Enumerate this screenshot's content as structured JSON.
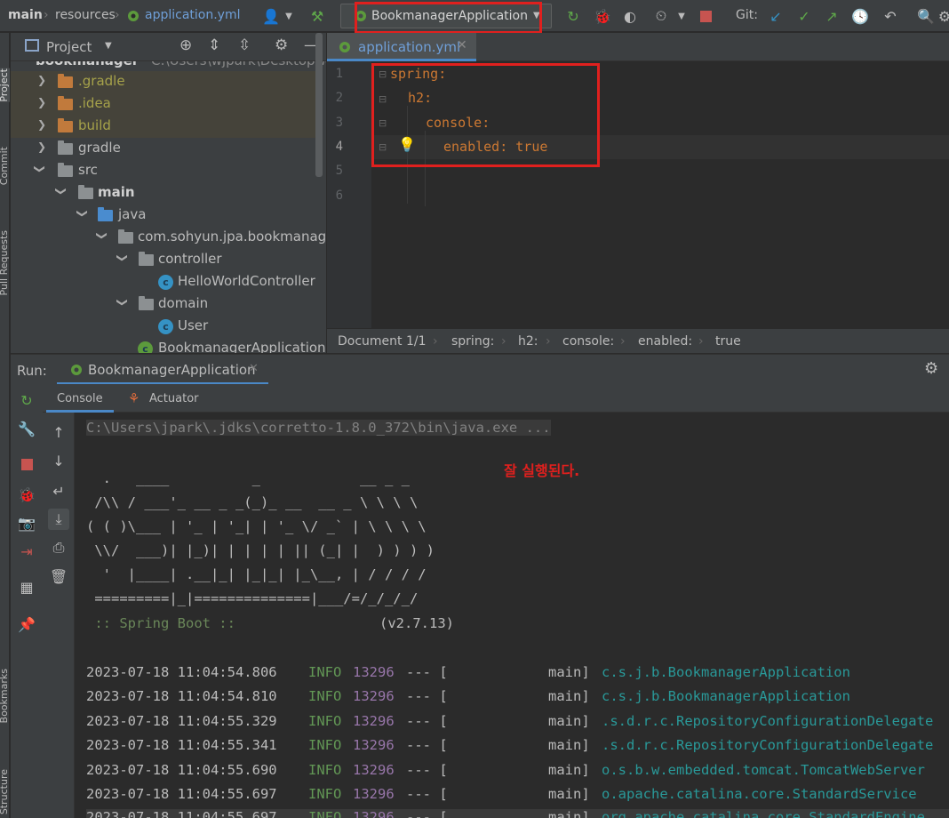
{
  "breadcrumbs": [
    "main",
    "resources",
    "application.yml"
  ],
  "run_config": {
    "label": "BookmanagerApplication"
  },
  "git_label": "Git:",
  "left_strip": {
    "project": "Project",
    "commit": "Commit",
    "pull_requests": "Pull Requests",
    "bookmarks": "Bookmarks",
    "structure": "Structure"
  },
  "project_panel": {
    "title": "Project",
    "tree": [
      {
        "label": "bookmanager",
        "path": "C:\\Users\\wjpark\\Desktop\\wo",
        "level": 0
      },
      {
        "label": ".gradle",
        "level": 1,
        "expanded": false,
        "type": "folder-excluded"
      },
      {
        "label": ".idea",
        "level": 1,
        "expanded": false,
        "type": "folder-excluded"
      },
      {
        "label": "build",
        "level": 1,
        "expanded": false,
        "type": "folder-excluded"
      },
      {
        "label": "gradle",
        "level": 1,
        "expanded": false,
        "type": "folder"
      },
      {
        "label": "src",
        "level": 1,
        "expanded": true,
        "type": "folder"
      },
      {
        "label": "main",
        "level": 2,
        "expanded": true,
        "type": "folder"
      },
      {
        "label": "java",
        "level": 3,
        "expanded": true,
        "type": "folder-source"
      },
      {
        "label": "com.sohyun.jpa.bookmanager",
        "level": 4,
        "expanded": true,
        "type": "package"
      },
      {
        "label": "controller",
        "level": 5,
        "expanded": true,
        "type": "package"
      },
      {
        "label": "HelloWorldController",
        "level": 6,
        "type": "class"
      },
      {
        "label": "domain",
        "level": 5,
        "expanded": true,
        "type": "package"
      },
      {
        "label": "User",
        "level": 6,
        "type": "class"
      },
      {
        "label": "BookmanagerApplication",
        "level": 5,
        "type": "class"
      }
    ]
  },
  "editor": {
    "tab_label": "application.yml",
    "line_numbers": [
      "1",
      "2",
      "3",
      "4",
      "5",
      "6"
    ],
    "lines": [
      {
        "key": "spring",
        "value": ""
      },
      {
        "key": "h2",
        "value": ""
      },
      {
        "key": "console",
        "value": ""
      },
      {
        "key": "enabled",
        "value": "true"
      }
    ],
    "breadcrumb": [
      "Document 1/1",
      "spring:",
      "h2:",
      "console:",
      "enabled:",
      "true"
    ]
  },
  "run_panel": {
    "label": "Run:",
    "tab_label": "BookmanagerApplication",
    "subtabs": [
      "Console",
      "Actuator"
    ],
    "command_line": "C:\\Users\\jpark\\.jdks\\corretto-1.8.0_372\\bin\\java.exe ...",
    "annotation": "잘 실행된다.",
    "banner": [
      "  .   ____          _            __ _ _",
      " /\\\\ / ___'_ __ _ _(_)_ __  __ _ \\ \\ \\ \\",
      "( ( )\\___ | '_ | '_| | '_ \\/ _` | \\ \\ \\ \\",
      " \\\\/  ___)| |_)| | | | | || (_| |  ) ) ) )",
      "  '  |____| .__|_| |_|_| |_\\__, | / / / /",
      " =========|_|==============|___/=/_/_/_/"
    ],
    "spring_boot_label": " :: Spring Boot ::",
    "spring_boot_version": "(v2.7.13)",
    "logs": [
      {
        "time": "2023-07-18 11:04:54.806",
        "level": "INFO",
        "pid": "13296",
        "sep": "--- [",
        "thread": "main]",
        "logger": "c.s.j.b.BookmanagerApplication"
      },
      {
        "time": "2023-07-18 11:04:54.810",
        "level": "INFO",
        "pid": "13296",
        "sep": "--- [",
        "thread": "main]",
        "logger": "c.s.j.b.BookmanagerApplication"
      },
      {
        "time": "2023-07-18 11:04:55.329",
        "level": "INFO",
        "pid": "13296",
        "sep": "--- [",
        "thread": "main]",
        "logger": ".s.d.r.c.RepositoryConfigurationDelegate"
      },
      {
        "time": "2023-07-18 11:04:55.341",
        "level": "INFO",
        "pid": "13296",
        "sep": "--- [",
        "thread": "main]",
        "logger": ".s.d.r.c.RepositoryConfigurationDelegate"
      },
      {
        "time": "2023-07-18 11:04:55.690",
        "level": "INFO",
        "pid": "13296",
        "sep": "--- [",
        "thread": "main]",
        "logger": "o.s.b.w.embedded.tomcat.TomcatWebServer"
      },
      {
        "time": "2023-07-18 11:04:55.697",
        "level": "INFO",
        "pid": "13296",
        "sep": "--- [",
        "thread": "main]",
        "logger": "o.apache.catalina.core.StandardService"
      },
      {
        "time": "2023-07-18 11:04:55.697",
        "level": "INFO",
        "pid": "13296",
        "sep": "--- [",
        "thread": "main]",
        "logger": "org.apache.catalina.core.StandardEngine"
      }
    ]
  }
}
